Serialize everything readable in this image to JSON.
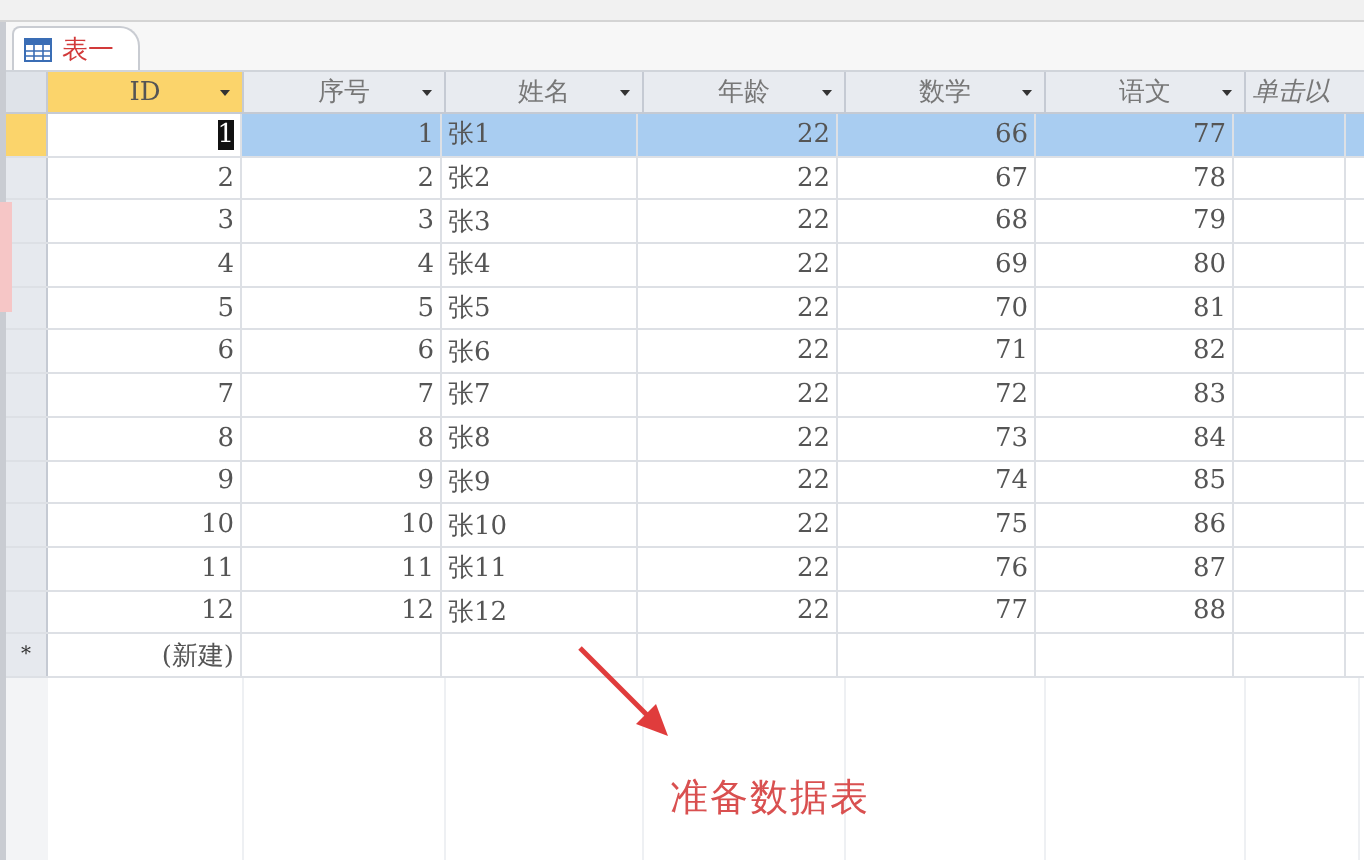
{
  "tab": {
    "label": "表一",
    "selected": true
  },
  "table": {
    "columns": [
      {
        "label": "ID",
        "selected": true
      },
      {
        "label": "序号",
        "selected": false
      },
      {
        "label": "姓名",
        "selected": false
      },
      {
        "label": "年龄",
        "selected": false
      },
      {
        "label": "数学",
        "selected": false
      },
      {
        "label": "语文",
        "selected": false
      },
      {
        "label": "单击以",
        "selected": false,
        "kind": "add"
      }
    ],
    "rows": [
      {
        "selected": true,
        "cells": [
          "1",
          "1",
          "张1",
          "22",
          "66",
          "77"
        ]
      },
      {
        "selected": false,
        "cells": [
          "2",
          "2",
          "张2",
          "22",
          "67",
          "78"
        ]
      },
      {
        "selected": false,
        "cells": [
          "3",
          "3",
          "张3",
          "22",
          "68",
          "79"
        ]
      },
      {
        "selected": false,
        "cells": [
          "4",
          "4",
          "张4",
          "22",
          "69",
          "80"
        ]
      },
      {
        "selected": false,
        "cells": [
          "5",
          "5",
          "张5",
          "22",
          "70",
          "81"
        ]
      },
      {
        "selected": false,
        "cells": [
          "6",
          "6",
          "张6",
          "22",
          "71",
          "82"
        ]
      },
      {
        "selected": false,
        "cells": [
          "7",
          "7",
          "张7",
          "22",
          "72",
          "83"
        ]
      },
      {
        "selected": false,
        "cells": [
          "8",
          "8",
          "张8",
          "22",
          "73",
          "84"
        ]
      },
      {
        "selected": false,
        "cells": [
          "9",
          "9",
          "张9",
          "22",
          "74",
          "85"
        ]
      },
      {
        "selected": false,
        "cells": [
          "10",
          "10",
          "张10",
          "22",
          "75",
          "86"
        ]
      },
      {
        "selected": false,
        "cells": [
          "11",
          "11",
          "张11",
          "22",
          "76",
          "87"
        ]
      },
      {
        "selected": false,
        "cells": [
          "12",
          "12",
          "张12",
          "22",
          "77",
          "88"
        ]
      }
    ],
    "new_row": {
      "marker": "*",
      "label": "(新建)"
    }
  },
  "annotation": "准备数据表"
}
